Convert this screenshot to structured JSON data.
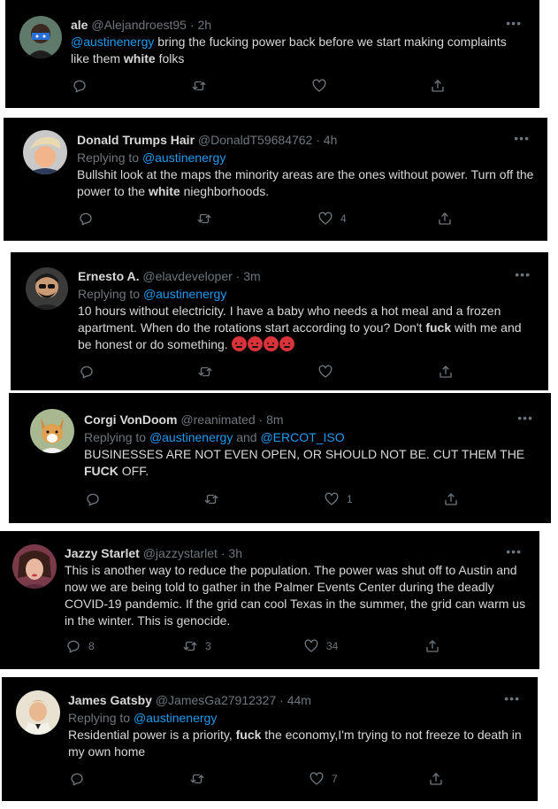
{
  "tweets": [
    {
      "name": "ale",
      "handle": "@Alejandroest95",
      "time": "2h",
      "reply_prefix": "",
      "reply_to": [],
      "body": [
        {
          "t": "@austinenergy",
          "s": "mention"
        },
        {
          "t": " bring the fucking power back before we start making complaints like them "
        },
        {
          "t": "white",
          "s": "bold"
        },
        {
          "t": " folks"
        }
      ],
      "counts": {
        "reply": "",
        "retweet": "",
        "like": ""
      }
    },
    {
      "name": "Donald Trumps Hair",
      "handle": "@DonaldT59684762",
      "time": "4h",
      "reply_prefix": "Replying to ",
      "reply_to": [
        "@austinenergy"
      ],
      "body": [
        {
          "t": "Bullshit look at the maps the minority areas are the ones without power. Turn off the power to the "
        },
        {
          "t": "white",
          "s": "bold"
        },
        {
          "t": " nieghborhoods."
        }
      ],
      "counts": {
        "reply": "",
        "retweet": "",
        "like": "4"
      }
    },
    {
      "name": "Ernesto A.",
      "handle": "@elavdeveloper",
      "time": "3m",
      "reply_prefix": "Replying to ",
      "reply_to": [
        "@austinenergy"
      ],
      "body": [
        {
          "t": "10 hours without electricity. I have a baby who needs a hot meal and a frozen apartment. When do the rotations start according to you?  Don't "
        },
        {
          "t": "fuck",
          "s": "bold"
        },
        {
          "t": " with me and be honest or do something. "
        },
        {
          "t": "",
          "s": "emoji"
        },
        {
          "t": "",
          "s": "emoji"
        },
        {
          "t": "",
          "s": "emoji"
        },
        {
          "t": "",
          "s": "emoji"
        }
      ],
      "counts": {
        "reply": "",
        "retweet": "",
        "like": ""
      }
    },
    {
      "name": "Corgi VonDoom",
      "handle": "@reanimated",
      "time": "8m",
      "reply_prefix": "Replying to ",
      "reply_to": [
        "@austinenergy",
        "@ERCOT_ISO"
      ],
      "reply_joiner": " and ",
      "body": [
        {
          "t": "BUSINESSES ARE NOT EVEN OPEN, OR SHOULD NOT BE. CUT THEM THE "
        },
        {
          "t": "FUCK",
          "s": "bold"
        },
        {
          "t": " OFF."
        }
      ],
      "counts": {
        "reply": "",
        "retweet": "",
        "like": "1"
      }
    },
    {
      "name": "Jazzy Starlet",
      "handle": "@jazzystarlet",
      "time": "3h",
      "reply_prefix": "",
      "reply_to": [],
      "body": [
        {
          "t": "This is another way to reduce the population. The power was shut off to Austin and now we are being told to gather in the Palmer Events Center during the deadly COVID-19 pandemic. If the grid can cool Texas in the summer, the grid can warm us in the winter. This is genocide."
        }
      ],
      "counts": {
        "reply": "8",
        "retweet": "3",
        "like": "34"
      }
    },
    {
      "name": "James Gatsby",
      "handle": "@JamesGa27912327",
      "time": "44m",
      "reply_prefix": "Replying to ",
      "reply_to": [
        "@austinenergy"
      ],
      "body": [
        {
          "t": "Residential power is a priority, "
        },
        {
          "t": "fuck",
          "s": "bold"
        },
        {
          "t": " the economy,I'm trying to not freeze to death in my own home"
        }
      ],
      "counts": {
        "reply": "",
        "retweet": "",
        "like": "7"
      }
    }
  ],
  "separator": " · ",
  "more_glyph": "•••",
  "colors": {
    "background": "#000000",
    "text": "#d9d9d9",
    "muted": "#6e767d",
    "mention": "#1d9bf0",
    "emoji": "#d8323a"
  }
}
